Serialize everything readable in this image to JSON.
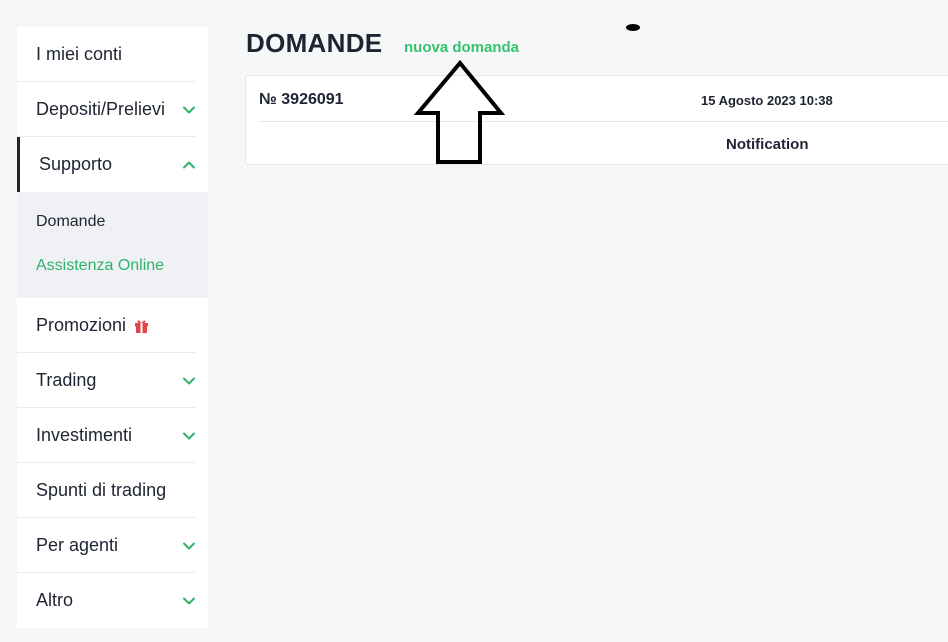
{
  "sidebar": {
    "items": [
      {
        "label": "I miei conti"
      },
      {
        "label": "Depositi/Prelievi"
      },
      {
        "label": "Supporto"
      },
      {
        "label": "Promozioni"
      },
      {
        "label": "Trading"
      },
      {
        "label": "Investimenti"
      },
      {
        "label": "Spunti di trading"
      },
      {
        "label": "Per agenti"
      },
      {
        "label": "Altro"
      }
    ],
    "support_submenu": [
      {
        "label": "Domande"
      },
      {
        "label": "Assistenza Online"
      }
    ]
  },
  "main": {
    "title": "DOMANDE",
    "new_question_label": "nuova domanda",
    "ticket": {
      "number": "№ 3926091",
      "date": "15 Agosto 2023 10:38",
      "subject": "Notification"
    }
  },
  "icons": {
    "chevron": "chevron-down-icon",
    "chevron_open": "chevron-up-icon",
    "gift": "gift-icon"
  },
  "colors": {
    "accent_green": "#2fb36b",
    "link_green": "#36c26f",
    "text_dark": "#1f2433",
    "gift_red": "#e0454b"
  }
}
